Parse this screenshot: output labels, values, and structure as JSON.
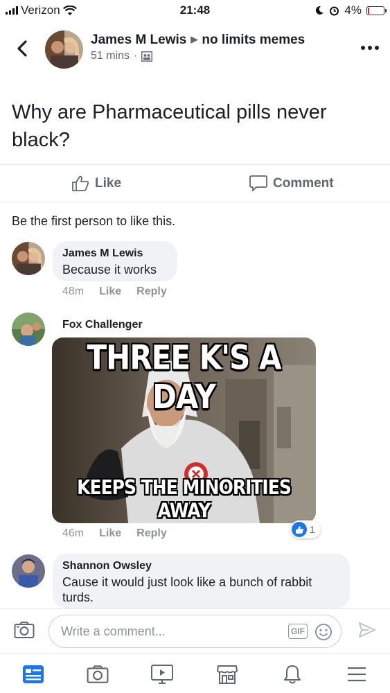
{
  "status_bar": {
    "carrier": "Verizon",
    "time": "21:48",
    "battery": "4%",
    "battery_level": 0.04
  },
  "post": {
    "author": "James M Lewis",
    "group": "no limits memes",
    "time": "51 mins",
    "text": "Why are Pharmaceutical pills never black?",
    "like_label": "Like",
    "comment_label": "Comment",
    "likes_summary": "Be the first person to like this."
  },
  "comments": [
    {
      "author": "James M Lewis",
      "text": "Because it works",
      "time": "48m",
      "like_label": "Like",
      "reply_label": "Reply"
    },
    {
      "author": "Fox Challenger",
      "image_top_text": "THREE K'S A DAY",
      "image_bottom_text": "KEEPS THE MINORITIES AWAY",
      "time": "46m",
      "like_label": "Like",
      "reply_label": "Reply",
      "reaction_count": "1"
    },
    {
      "author": "Shannon Owsley",
      "text": "Cause it would just look like a bunch of rabbit turds."
    }
  ],
  "composer": {
    "placeholder": "Write a comment...",
    "gif_label": "GIF"
  },
  "nav": [
    "news-feed-icon",
    "camera-icon",
    "watch-icon",
    "marketplace-icon",
    "notifications-icon",
    "menu-icon"
  ],
  "colors": {
    "accent": "#1877f2",
    "text": "#1c1e21",
    "muted": "#606770",
    "bubble": "#f0f2f5"
  }
}
